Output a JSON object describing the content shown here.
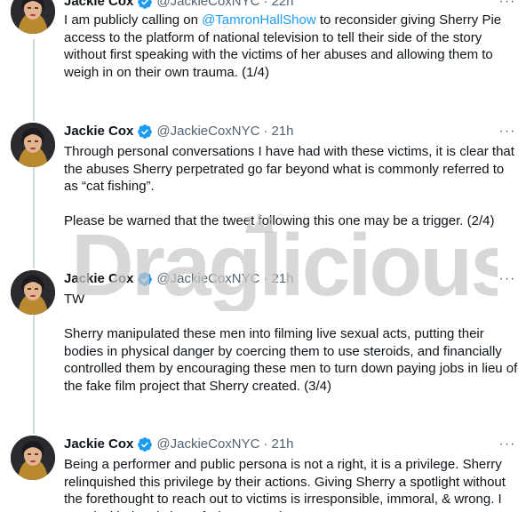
{
  "colors": {
    "accent": "#1d9bf0",
    "text": "#0f1419",
    "secondary": "#536471",
    "thread_line": "#cfd9de",
    "watermark": "#c9c9c9"
  },
  "icons": {
    "verified": "verified-badge-icon",
    "more": "more-options-icon"
  },
  "watermark": {
    "text": "Draglicious"
  },
  "tweets": [
    {
      "name": "Jackie Cox",
      "handle": "@JackieCoxNYC",
      "separator": "·",
      "time": "22h",
      "more": "···",
      "text_1": "I am publicly calling on ",
      "mention": "@TamronHallShow",
      "text_2": " to reconsider giving Sherry Pie access to the platform of national television to tell their side of the story without first speaking with the victims of her abuses and allowing them to weigh in on their own trauma. (1/4)"
    },
    {
      "name": "Jackie Cox",
      "handle": "@JackieCoxNYC",
      "separator": "·",
      "time": "21h",
      "more": "···",
      "text": "Through personal conversations I have had with these victims, it is clear that the abuses Sherry perpetrated go far beyond what is commonly referred to as “cat fishing”.\n\nPlease be warned that the tweet following this one may be a trigger. (2/4)"
    },
    {
      "name": "Jackie Cox",
      "handle": "@JackieCoxNYC",
      "separator": "·",
      "time": "21h",
      "more": "···",
      "text": "TW\n\nSherry manipulated these men into filming live sexual acts, putting their bodies in physical danger by coercing them to use steroids, and financially controlled them by encouraging these men to turn down paying jobs in lieu of the fake film project that Sherry created. (3/4)"
    },
    {
      "name": "Jackie Cox",
      "handle": "@JackieCoxNYC",
      "separator": "·",
      "time": "21h",
      "more": "···",
      "text": "Being a performer and public persona is not a right, it is a privilege. Sherry relinquished this privilege by their actions. Giving Sherry a spotlight without the forethought to reach out to victims is irresponsible, immoral, & wrong. I stand with the victims of Sherry's actions."
    }
  ]
}
